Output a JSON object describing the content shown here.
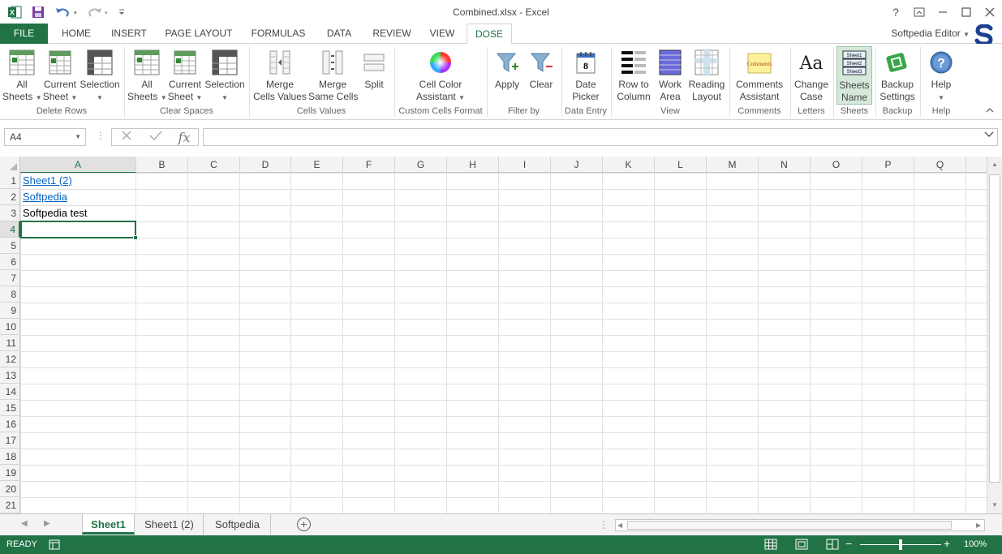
{
  "window": {
    "title": "Combined.xlsx - Excel",
    "help": "?",
    "user": "Softpedia Editor"
  },
  "tabs": [
    "FILE",
    "HOME",
    "INSERT",
    "PAGE LAYOUT",
    "FORMULAS",
    "DATA",
    "REVIEW",
    "VIEW",
    "DOSE"
  ],
  "ribbon": {
    "groups": [
      {
        "label": "Delete Rows",
        "buttons": [
          [
            "All",
            "Sheets"
          ],
          [
            "Current",
            "Sheet"
          ],
          [
            "Selection",
            ""
          ]
        ]
      },
      {
        "label": "Clear Spaces",
        "buttons": [
          [
            "All",
            "Sheets"
          ],
          [
            "Current",
            "Sheet"
          ],
          [
            "Selection",
            ""
          ]
        ]
      },
      {
        "label": "Cells Values",
        "buttons": [
          [
            "Merge",
            "Cells Values"
          ],
          [
            "Merge",
            "Same Cells"
          ],
          [
            "Split",
            ""
          ]
        ]
      },
      {
        "label": "Custom Cells Format",
        "buttons": [
          [
            "Cell Color",
            "Assistant"
          ]
        ]
      },
      {
        "label": "Filter by",
        "buttons": [
          [
            "Apply",
            ""
          ],
          [
            "Clear",
            ""
          ]
        ]
      },
      {
        "label": "Data Entry",
        "buttons": [
          [
            "Date",
            "Picker"
          ]
        ]
      },
      {
        "label": "View",
        "buttons": [
          [
            "Row to",
            "Column"
          ],
          [
            "Work",
            "Area"
          ],
          [
            "Reading",
            "Layout"
          ]
        ]
      },
      {
        "label": "Comments",
        "buttons": [
          [
            "Comments",
            "Assistant"
          ]
        ]
      },
      {
        "label": "Letters",
        "buttons": [
          [
            "Change",
            "Case"
          ]
        ]
      },
      {
        "label": "Sheets",
        "buttons": [
          [
            "Sheets",
            "Name"
          ]
        ]
      },
      {
        "label": "Backup",
        "buttons": [
          [
            "Backup",
            "Settings"
          ]
        ]
      },
      {
        "label": "Help",
        "buttons": [
          [
            "Help",
            ""
          ]
        ]
      }
    ],
    "icon_texts": {
      "date_day": "8",
      "comments": "Comments",
      "case": "Aa",
      "sheet1": "Sheet1",
      "sheet2": "Sheet2",
      "sheet3": "Sheet3"
    }
  },
  "formula_bar": {
    "name_box": "A4",
    "fx": "fx",
    "content": ""
  },
  "grid": {
    "columns": [
      "A",
      "B",
      "C",
      "D",
      "E",
      "F",
      "G",
      "H",
      "I",
      "J",
      "K",
      "L",
      "M",
      "N",
      "O",
      "P",
      "Q"
    ],
    "rows": [
      "1",
      "2",
      "3",
      "4",
      "5",
      "6",
      "7",
      "8",
      "9",
      "10",
      "11",
      "12",
      "13",
      "14",
      "15",
      "16",
      "17",
      "18",
      "19",
      "20",
      "21"
    ],
    "selected_row": "4",
    "selected_col": "A",
    "cells": {
      "A1": "Sheet1 (2)",
      "A2": "Softpedia",
      "A3": "Softpedia test"
    }
  },
  "sheets": [
    "Sheet1",
    "Sheet1 (2)",
    "Softpedia"
  ],
  "active_sheet": "Sheet1",
  "status": {
    "mode": "READY",
    "zoom": "100%"
  },
  "colors": {
    "accent": "#217346",
    "link": "#0563c1"
  }
}
